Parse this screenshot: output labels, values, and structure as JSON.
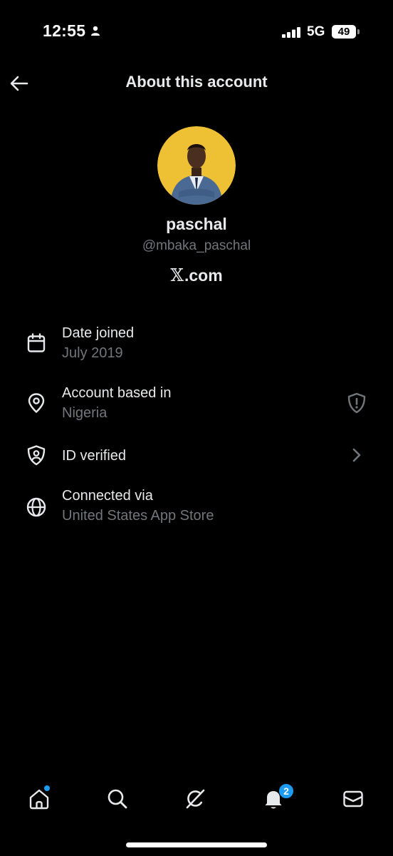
{
  "status_bar": {
    "time": "12:55",
    "network": "5G",
    "battery": "49"
  },
  "header": {
    "title": "About this account"
  },
  "profile": {
    "display_name": "paschal",
    "handle": "@mbaka_paschal",
    "platform_mark": "𝕏",
    "platform_suffix": ".com",
    "avatar_bg": "#f0c63a"
  },
  "info": {
    "date_joined": {
      "label": "Date joined",
      "value": "July 2019",
      "icon": "calendar-icon"
    },
    "based_in": {
      "label": "Account based in",
      "value": "Nigeria",
      "icon": "location-pin-icon",
      "trailing_icon": "shield-alert-icon"
    },
    "id_verified": {
      "label": "ID verified",
      "icon": "id-shield-icon",
      "trailing_icon": "chevron-right-icon"
    },
    "connected_via": {
      "label": "Connected via",
      "value": "United States App Store",
      "icon": "globe-icon"
    }
  },
  "tab_bar": {
    "tabs": [
      "home-icon",
      "search-icon",
      "grok-icon",
      "bell-icon",
      "mail-icon"
    ],
    "notification_count": "2"
  },
  "colors": {
    "accent": "#1d9bf0",
    "text_primary": "#e7e9ea",
    "text_secondary": "#71767b",
    "background": "#000000"
  }
}
